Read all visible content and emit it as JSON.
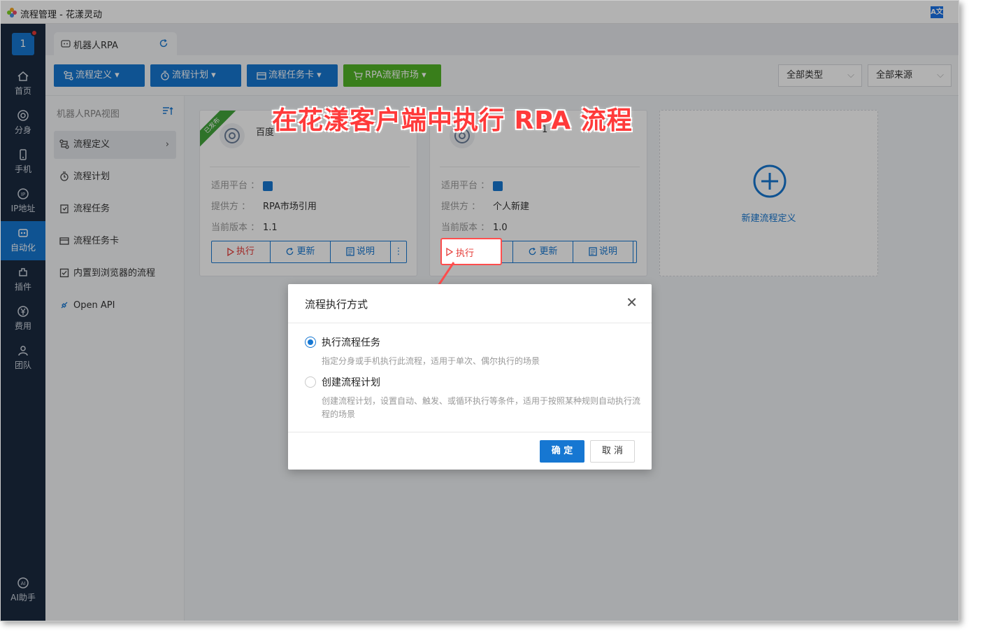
{
  "window": {
    "title": "流程管理 - 花漾灵动"
  },
  "sidebar": {
    "avatar": "1",
    "items": [
      {
        "label": "首页",
        "icon": "home-icon"
      },
      {
        "label": "分身",
        "icon": "browser-icon"
      },
      {
        "label": "手机",
        "icon": "phone-icon"
      },
      {
        "label": "IP地址",
        "icon": "ip-icon"
      },
      {
        "label": "自动化",
        "icon": "robot-icon"
      },
      {
        "label": "插件",
        "icon": "plugin-icon"
      },
      {
        "label": "费用",
        "icon": "yen-icon"
      },
      {
        "label": "团队",
        "icon": "team-icon"
      }
    ],
    "ai_label": "AI助手"
  },
  "tab": {
    "label": "机器人RPA"
  },
  "toolbar": {
    "buttons": [
      "流程定义",
      "流程计划",
      "流程任务卡",
      "RPA流程市场"
    ],
    "type_select": "全部类型",
    "source_select": "全部来源"
  },
  "leftnav": {
    "title": "机器人RPA视图",
    "items": [
      "流程定义",
      "流程计划",
      "流程任务",
      "流程任务卡",
      "内置到浏览器的流程",
      "Open API"
    ]
  },
  "cards": [
    {
      "ribbon": "已发布",
      "title": "百度",
      "platform_label": "适用平台 ：",
      "provider_label": "提供方 ：",
      "provider": "RPA市场引用",
      "version_label": "当前版本 ：",
      "version": "1.1"
    },
    {
      "title": "1",
      "platform_label": "适用平台 ：",
      "provider_label": "提供方 ：",
      "provider": "个人新建",
      "version_label": "当前版本 ：",
      "version": "1.0"
    }
  ],
  "card_buttons": {
    "exec": "执行",
    "update": "更新",
    "info": "说明"
  },
  "new_card": {
    "label": "新建流程定义"
  },
  "annotation": "在花漾客户端中执行 RPA 流程",
  "dialog": {
    "title": "流程执行方式",
    "option1": {
      "label": "执行流程任务",
      "desc": "指定分身或手机执行此流程，适用于单次、偶尔执行的场景"
    },
    "option2": {
      "label": "创建流程计划",
      "desc": "创建流程计划，设置自动、触发、或循环执行等条件，适用于按照某种规则自动执行流程的场景"
    },
    "ok": "确 定",
    "cancel": "取 消"
  },
  "colors": {
    "primary": "#1677d2",
    "green": "#52b527",
    "danger": "#e53935",
    "sidebar": "#1b2a3f"
  }
}
